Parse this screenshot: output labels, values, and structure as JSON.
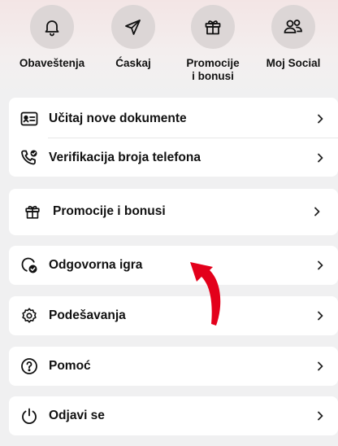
{
  "quick_actions": [
    {
      "label": "Obaveštenja",
      "icon": "bell-icon"
    },
    {
      "label": "Ćaskaj",
      "icon": "send-icon"
    },
    {
      "label": "Promocije\ni bonusi",
      "icon": "gift-icon"
    },
    {
      "label": "Moj Social",
      "icon": "users-icon"
    }
  ],
  "menu": {
    "documents": {
      "label": "Učitaj nove dokumente",
      "icon": "id-card-icon"
    },
    "phone": {
      "label": "Verifikacija broja telefona",
      "icon": "phone-check-icon"
    },
    "promotions": {
      "label": "Promocije i bonusi",
      "icon": "gift-icon"
    },
    "responsible": {
      "label": "Odgovorna igra",
      "icon": "shield-check-icon"
    },
    "settings": {
      "label": "Podešavanja",
      "icon": "gear-icon"
    },
    "help": {
      "label": "Pomoć",
      "icon": "question-icon"
    },
    "logout": {
      "label": "Odjavi se",
      "icon": "power-icon"
    }
  },
  "colors": {
    "accent": "#e3001b",
    "card": "#ffffff",
    "background": "#f0f0f1",
    "circle": "#dcd6d6"
  }
}
